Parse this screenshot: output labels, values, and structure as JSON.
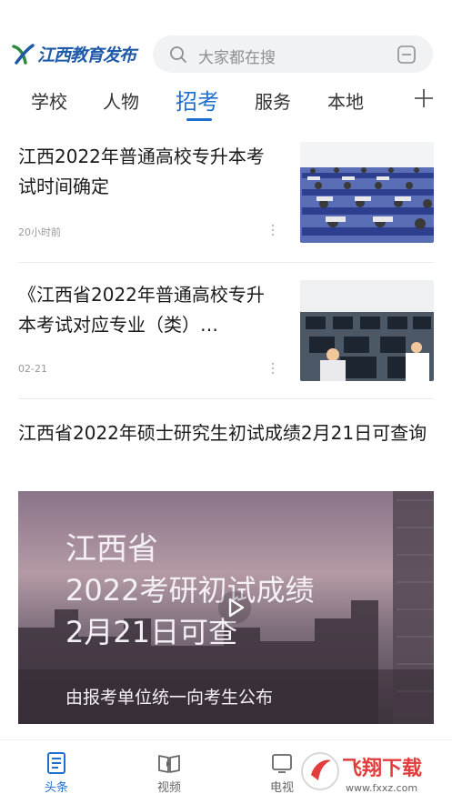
{
  "header": {
    "logo_text": "江西教育发布",
    "search_placeholder": "大家都在搜"
  },
  "tabs": [
    {
      "label": "学校",
      "active": false
    },
    {
      "label": "人物",
      "active": false
    },
    {
      "label": "招考",
      "active": true
    },
    {
      "label": "服务",
      "active": false
    },
    {
      "label": "本地",
      "active": false
    }
  ],
  "articles": [
    {
      "title": "江西2022年普通高校专升本考试时间确定",
      "meta": "20小时前"
    },
    {
      "title": "《江西省2022年普通高校专升本考试对应专业（类）…",
      "meta": "02-21"
    }
  ],
  "video_article": {
    "title": "江西省2022年硕士研究生初试成绩2月21日可查询",
    "cover_lines": [
      "江西省",
      "2022考研初试成绩",
      "2月21日可查",
      "由报考单位统一向考生公布"
    ]
  },
  "bottom_nav": [
    {
      "label": "头条",
      "icon": "news-icon",
      "active": true
    },
    {
      "label": "视频",
      "icon": "video-book-icon",
      "active": false
    },
    {
      "label": "电视",
      "icon": "tv-icon",
      "active": false
    }
  ],
  "watermark": {
    "text_main": "飞翔下载",
    "text_url": "www.fxxz.com"
  },
  "colors": {
    "accent": "#1f6fd1",
    "logo": "#1f5aa8",
    "watermark": "#e23c3c"
  }
}
